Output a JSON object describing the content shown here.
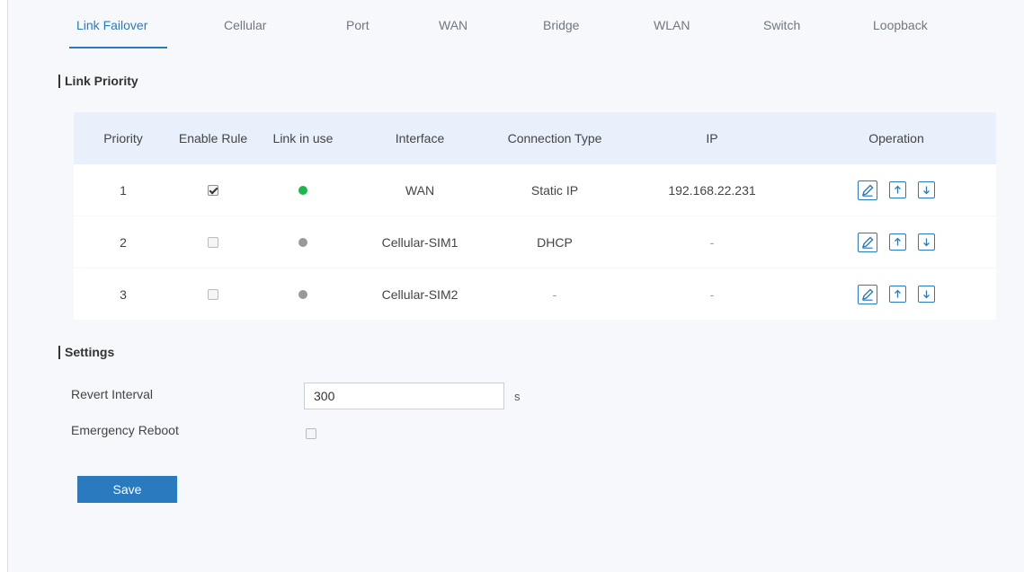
{
  "tabs": [
    {
      "label": "Link Failover",
      "active": true
    },
    {
      "label": "Cellular"
    },
    {
      "label": "Port"
    },
    {
      "label": "WAN"
    },
    {
      "label": "Bridge"
    },
    {
      "label": "WLAN"
    },
    {
      "label": "Switch"
    },
    {
      "label": "Loopback"
    }
  ],
  "link_priority": {
    "title": "Link Priority",
    "columns": [
      "Priority",
      "Enable Rule",
      "Link in use",
      "Interface",
      "Connection Type",
      "IP",
      "Operation"
    ],
    "rows": [
      {
        "priority": "1",
        "enabled": true,
        "link_in_use": true,
        "interface": "WAN",
        "connection_type": "Static IP",
        "ip": "192.168.22.231"
      },
      {
        "priority": "2",
        "enabled": false,
        "link_in_use": false,
        "interface": "Cellular-SIM1",
        "connection_type": "DHCP",
        "ip": "-"
      },
      {
        "priority": "3",
        "enabled": false,
        "link_in_use": false,
        "interface": "Cellular-SIM2",
        "connection_type": "-",
        "ip": "-"
      }
    ],
    "operation_icons": [
      "edit-icon",
      "arrow-up-icon",
      "arrow-down-icon"
    ]
  },
  "settings": {
    "title": "Settings",
    "revert_interval_label": "Revert Interval",
    "revert_interval_value": "300",
    "revert_interval_unit": "s",
    "emergency_reboot_label": "Emergency Reboot",
    "emergency_reboot_checked": false
  },
  "save_label": "Save",
  "colors": {
    "accent": "#2a7ac0",
    "link_active": "#18b94a",
    "link_inactive": "#999999",
    "table_header_bg": "#e8f1fb"
  }
}
